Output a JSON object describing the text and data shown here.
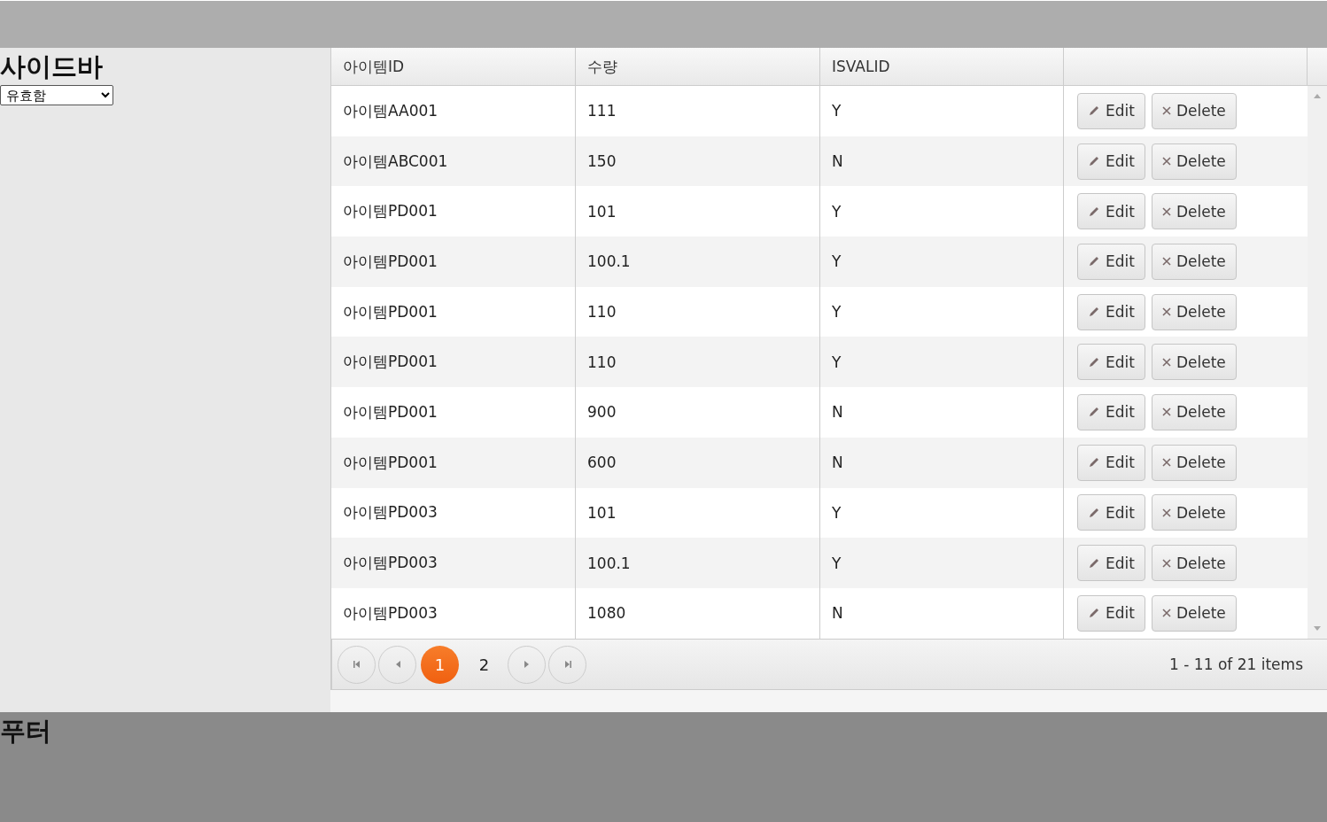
{
  "sidebar": {
    "title": "사이드바",
    "filter": {
      "value": "유효함"
    }
  },
  "grid": {
    "columns": [
      "아이템ID",
      "수량",
      "ISVALID"
    ],
    "rows": [
      {
        "cells": [
          "아이템AA001",
          "111",
          "Y"
        ],
        "actions": [
          "Edit",
          "Delete"
        ]
      },
      {
        "cells": [
          "아이템ABC001",
          "150",
          "N"
        ],
        "actions": [
          "Edit",
          "Delete"
        ]
      },
      {
        "cells": [
          "아이템PD001",
          "101",
          "Y"
        ],
        "actions": [
          "Edit",
          "Delete"
        ]
      },
      {
        "cells": [
          "아이템PD001",
          "100.1",
          "Y"
        ],
        "actions": [
          "Edit",
          "Delete"
        ]
      },
      {
        "cells": [
          "아이템PD001",
          "110",
          "Y"
        ],
        "actions": [
          "Edit",
          "Delete"
        ]
      },
      {
        "cells": [
          "아이템PD001",
          "110",
          "Y"
        ],
        "actions": [
          "Edit",
          "Delete"
        ]
      },
      {
        "cells": [
          "아이템PD001",
          "900",
          "N"
        ],
        "actions": [
          "Edit",
          "Delete"
        ]
      },
      {
        "cells": [
          "아이템PD001",
          "600",
          "N"
        ],
        "actions": [
          "Edit",
          "Delete"
        ]
      },
      {
        "cells": [
          "아이템PD003",
          "101",
          "Y"
        ],
        "actions": [
          "Edit",
          "Delete"
        ]
      },
      {
        "cells": [
          "아이템PD003",
          "100.1",
          "Y"
        ],
        "actions": [
          "Edit",
          "Delete"
        ]
      },
      {
        "cells": [
          "아이템PD003",
          "1080",
          "N"
        ],
        "actions": [
          "Edit",
          "Delete"
        ]
      }
    ],
    "pager": {
      "pages": [
        {
          "label": "1",
          "selected": true
        },
        {
          "label": "2",
          "selected": false
        }
      ],
      "info": "1 - 11 of 21 items"
    }
  },
  "footer": {
    "title": "푸터"
  }
}
